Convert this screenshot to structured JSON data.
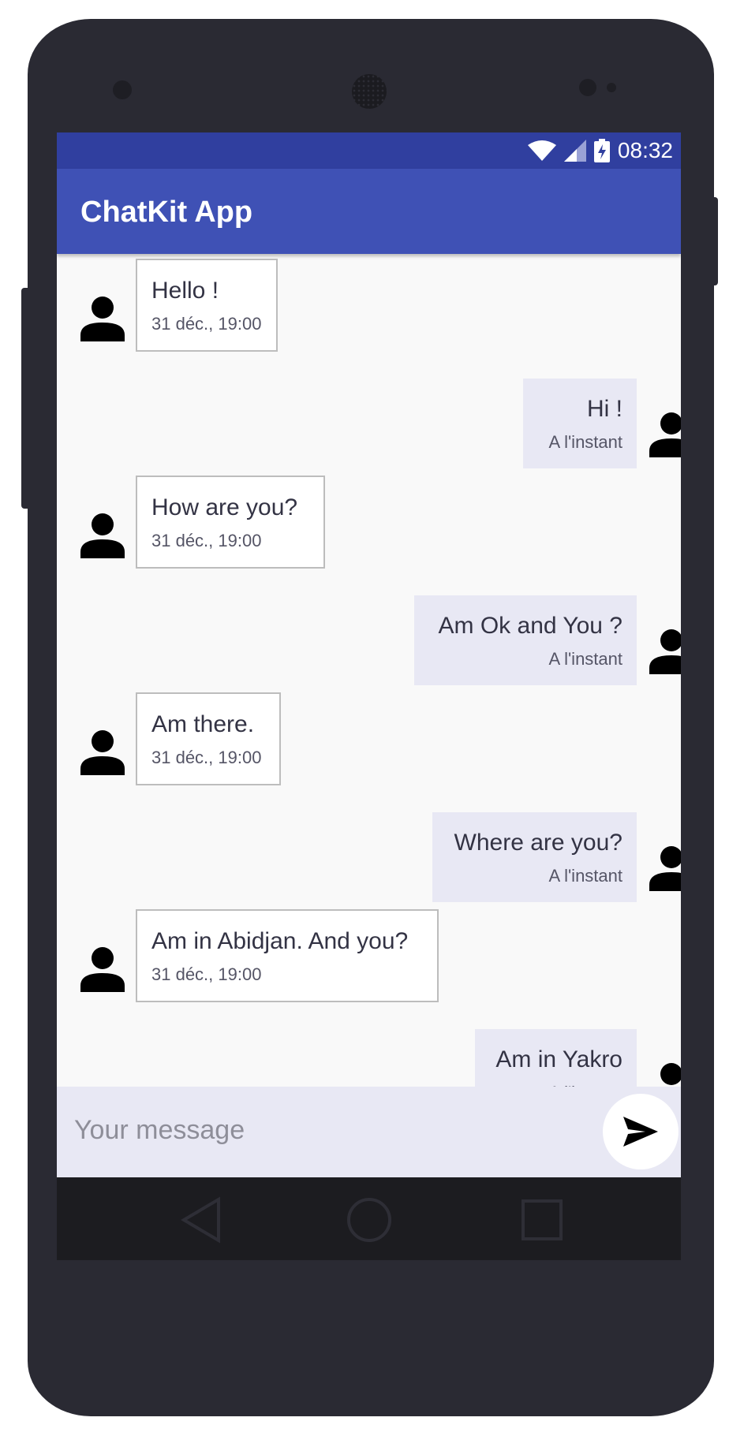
{
  "status_bar": {
    "time": "08:32"
  },
  "app_bar": {
    "title": "ChatKit App"
  },
  "messages": [
    {
      "direction": "incoming",
      "text": "Hello !",
      "time": "31 déc., 19:00"
    },
    {
      "direction": "outgoing",
      "text": "Hi !",
      "time": "A l'instant"
    },
    {
      "direction": "incoming",
      "text": "How are you?",
      "time": "31 déc., 19:00"
    },
    {
      "direction": "outgoing",
      "text": "Am Ok and You ?",
      "time": "A l'instant"
    },
    {
      "direction": "incoming",
      "text": "Am there.",
      "time": "31 déc., 19:00"
    },
    {
      "direction": "outgoing",
      "text": "Where are you?",
      "time": "A l'instant"
    },
    {
      "direction": "incoming",
      "text": "Am in Abidjan. And you?",
      "time": "31 déc., 19:00"
    },
    {
      "direction": "outgoing",
      "text": "Am in Yakro",
      "time": "A l'instant"
    }
  ],
  "input": {
    "placeholder": "Your message"
  },
  "colors": {
    "status_bar": "#303f9f",
    "app_bar": "#3f51b5",
    "outgoing_bubble": "#e8e8f4",
    "incoming_bubble": "#ffffff"
  },
  "icons": {
    "status": [
      "wifi-icon",
      "signal-icon",
      "battery-icon"
    ],
    "avatar": "person-icon",
    "send": "send-icon",
    "nav": [
      "back-icon",
      "home-icon",
      "recents-icon"
    ]
  }
}
